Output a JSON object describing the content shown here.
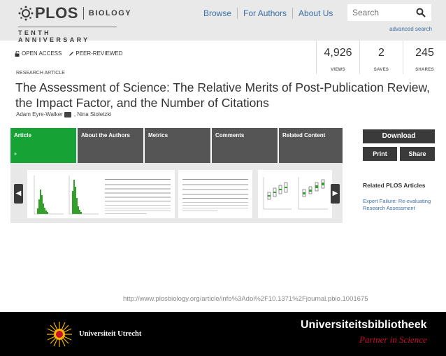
{
  "header": {
    "logo_text": "PLOS",
    "logo_sub": "BIOLOGY",
    "logo_tagline": "TENTH ANNIVERSARY",
    "nav": [
      "Browse",
      "For Authors",
      "About Us"
    ],
    "search_placeholder": "Search",
    "advanced_search": "advanced search"
  },
  "badges": {
    "open_access": "OPEN ACCESS",
    "peer_reviewed": "PEER-REVIEWED"
  },
  "metrics": [
    {
      "value": "4,926",
      "label": "VIEWS"
    },
    {
      "value": "2",
      "label": "SAVES"
    },
    {
      "value": "245",
      "label": "SHARES"
    }
  ],
  "article": {
    "type": "RESEARCH ARTICLE",
    "title": "The Assessment of Science: The Relative Merits of Post-Publication Review, the Impact Factor, and the Number of Citations",
    "author1": "Adam Eyre-Walker",
    "author2": "Nina Stoletzki"
  },
  "tabs": [
    "Article",
    "About the Authors",
    "Metrics",
    "Comments",
    "Related Content"
  ],
  "tab_chevron": "»",
  "carousel": {
    "prev": "◀",
    "next": "▶"
  },
  "sidebar": {
    "download": "Download",
    "print": "Print",
    "share": "Share",
    "related_title": "Related PLOS Articles",
    "related_link": "Expert Failure: Re-evaluating Research Assessment"
  },
  "url": "http://www.plosbiology.org/article/info%3Adoi%2F10.1371%2Fjournal.pbio.1001675",
  "footer": {
    "university": "Universiteit Utrecht",
    "library": "Universiteitsbibliotheek",
    "library_sub": "Partner in Science"
  },
  "colors": {
    "accent_green": "#16a235",
    "link_blue": "#3b6ea5",
    "footer_red": "#c8102e"
  }
}
